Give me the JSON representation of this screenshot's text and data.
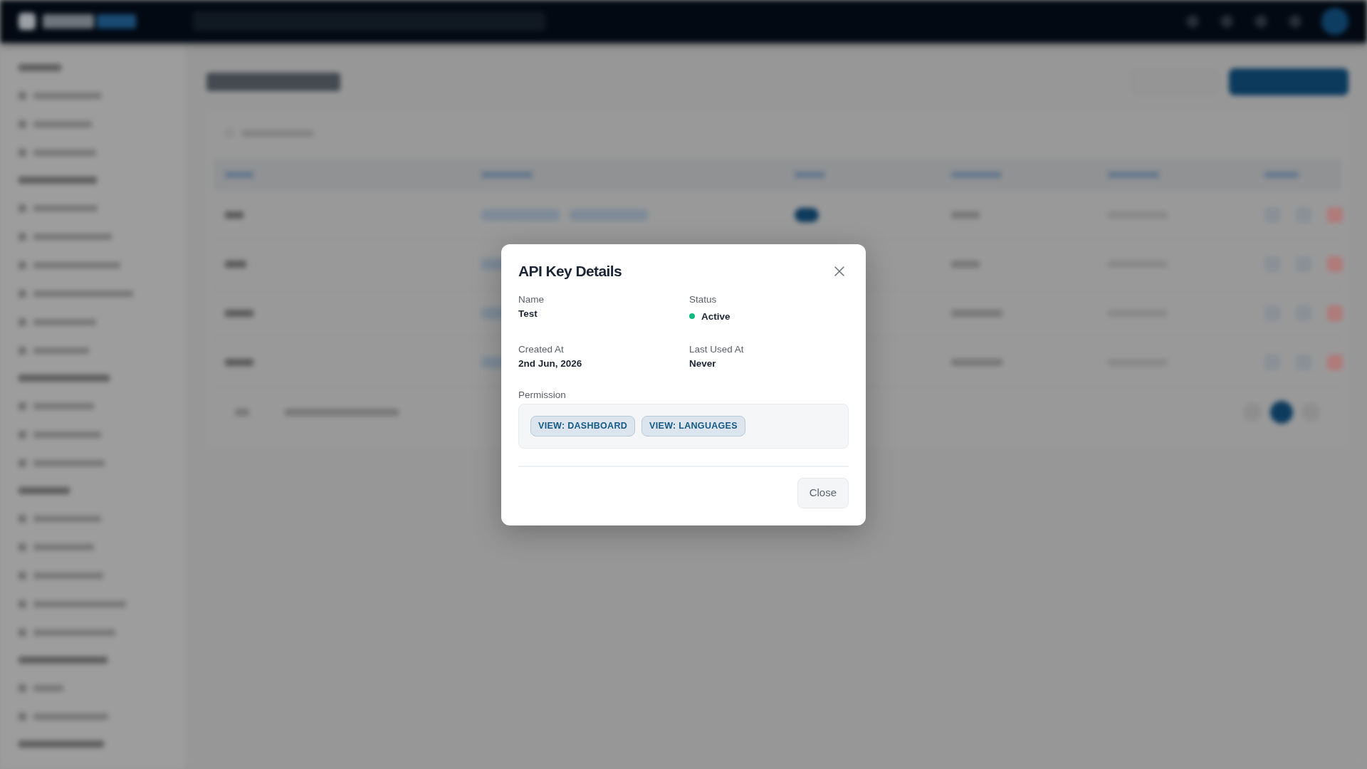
{
  "dialog": {
    "title": "API Key Details",
    "fields": [
      {
        "kind": "text",
        "label": "Name",
        "value": "Test"
      },
      {
        "kind": "status",
        "label": "Status",
        "value": "Active",
        "color": "#10b981"
      },
      {
        "kind": "text",
        "label": "Created At",
        "value": "2nd Jun, 2026"
      },
      {
        "kind": "text",
        "label": "Last Used At",
        "value": "Never"
      }
    ],
    "permission": {
      "label": "Permission",
      "tags": [
        "VIEW: DASHBOARD",
        "VIEW: LANGUAGES"
      ]
    },
    "buttons": [
      "Close"
    ]
  }
}
